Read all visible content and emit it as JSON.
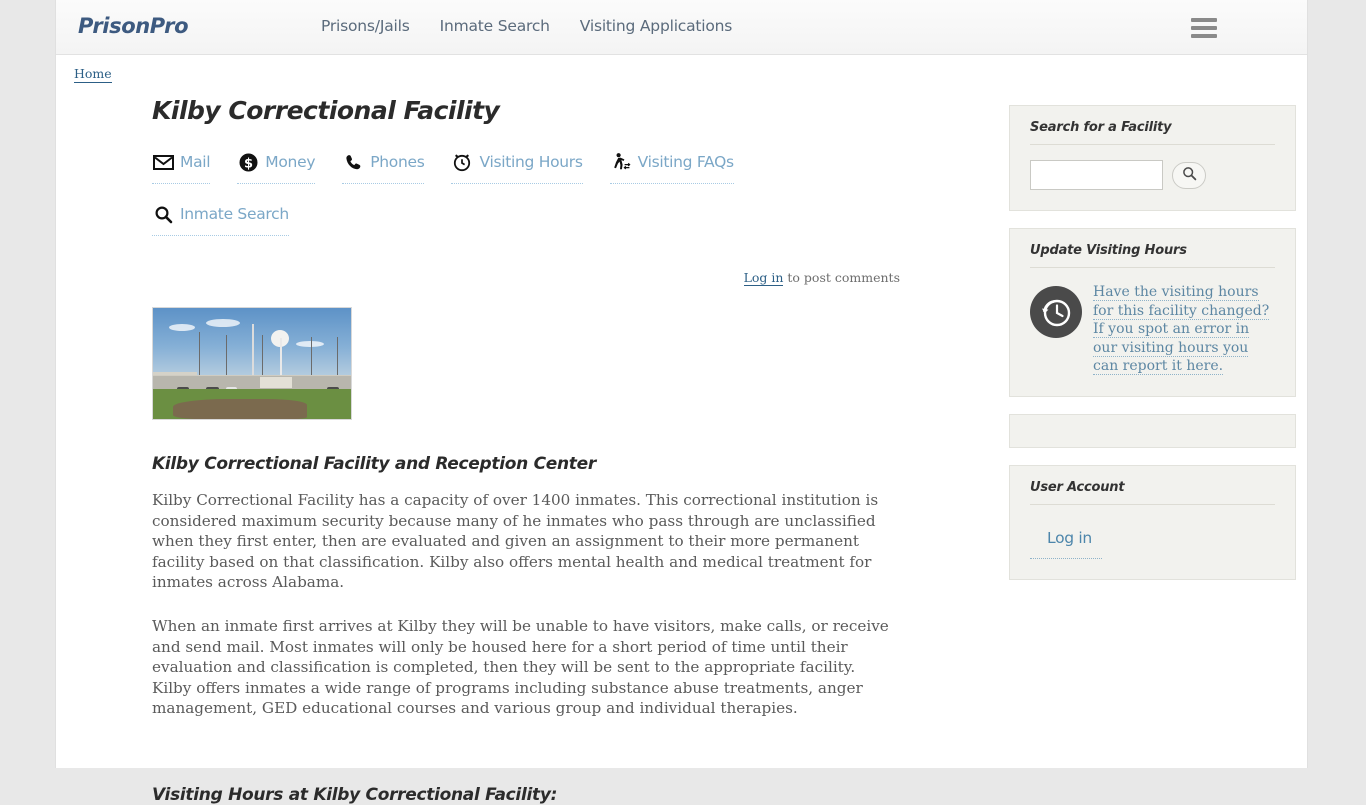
{
  "header": {
    "brand": "PrisonPro",
    "nav": [
      {
        "label": "Prisons/Jails"
      },
      {
        "label": "Inmate Search"
      },
      {
        "label": "Visiting Applications"
      }
    ],
    "menu_icon": "hamburger-icon"
  },
  "breadcrumb": {
    "home": "Home"
  },
  "main": {
    "title": "Kilby Correctional Facility",
    "icon_links": [
      {
        "label": "Mail",
        "icon": "envelope-icon"
      },
      {
        "label": "Money",
        "icon": "dollar-circle-icon"
      },
      {
        "label": "Phones",
        "icon": "phone-icon"
      },
      {
        "label": "Visiting Hours",
        "icon": "alarm-clock-icon"
      },
      {
        "label": "Visiting FAQs",
        "icon": "visitor-walking-icon"
      },
      {
        "label": "Inmate Search",
        "icon": "magnifier-icon"
      }
    ],
    "comments": {
      "login_label": "Log in",
      "rest_label": " to post comments"
    },
    "photo_alt": "kilby-correctional-facility-photo",
    "sub_heading": "Kilby Correctional Facility and Reception Center",
    "paragraphs": [
      "Kilby Correctional Facility has a capacity of over 1400 inmates.  This correctional institution is considered maximum security because many of he inmates who pass through are unclassified when they first enter, then are evaluated and given an assignment to their more permanent facility based on that classification.  Kilby also offers mental health and medical treatment for inmates across Alabama.",
      "When an inmate first arrives at Kilby they will be unable to have visitors, make calls, or receive and send mail.  Most inmates will only be housed here for a short period of time until their evaluation and classification is completed, then they will be sent to the appropriate facility.  Kilby offers inmates a wide range of programs including substance abuse treatments, anger management, GED educational courses and various group and individual therapies."
    ],
    "bottom_heading": "Visiting Hours at Kilby Correctional Facility:"
  },
  "sidebar": {
    "search_block": {
      "title": "Search for a Facility",
      "input_value": "",
      "input_placeholder": "",
      "button_icon": "magnifier-icon"
    },
    "update_block": {
      "title": "Update Visiting Hours",
      "icon": "clock-refresh-icon",
      "link_text": "Have the visiting hours for this facility changed?  If you spot an error in our visiting hours you can report it here."
    },
    "empty_block": "",
    "account_block": {
      "title": "User Account",
      "login_label": "Log in"
    }
  },
  "colors": {
    "brand": "#3d5a80",
    "link": "#7ba7c7",
    "serif_link": "#5d87a3",
    "body_text": "#5a5a5a",
    "sidebar_bg": "#f2f2ee"
  }
}
